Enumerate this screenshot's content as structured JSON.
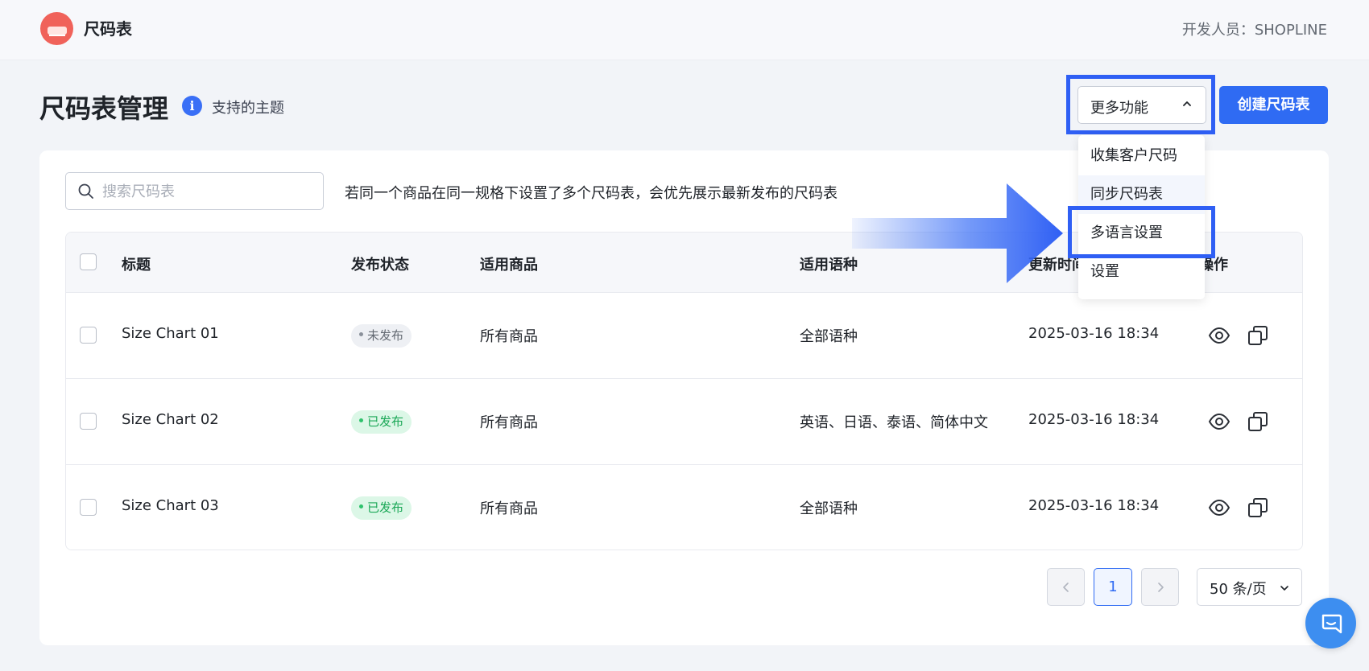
{
  "app": {
    "title": "尺码表",
    "developer": "开发人员：SHOPLINE"
  },
  "header": {
    "page_title": "尺码表管理",
    "themes_link": "支持的主题",
    "more_button": "更多功能",
    "create_button": "创建尺码表"
  },
  "more_menu": {
    "items": [
      "收集客户尺码",
      "同步尺码表",
      "多语言设置",
      "设置"
    ]
  },
  "search": {
    "placeholder": "搜索尺码表",
    "value": ""
  },
  "notice": "若同一个商品在同一规格下设置了多个尺码表，会优先展示最新发布的尺码表",
  "table": {
    "columns": [
      "标题",
      "发布状态",
      "适用商品",
      "适用语种",
      "更新时间",
      "操作"
    ],
    "rows": [
      {
        "title": "Size Chart 01",
        "status": "未发布",
        "products": "所有商品",
        "languages": "全部语种",
        "updated": "2025-03-16 18:34"
      },
      {
        "title": "Size Chart 02",
        "status": "已发布",
        "products": "所有商品",
        "languages": "英语、日语、泰语、简体中文",
        "updated": "2025-03-16 18:34"
      },
      {
        "title": "Size Chart 03",
        "status": "已发布",
        "products": "所有商品",
        "languages": "全部语种",
        "updated": "2025-03-16 18:34"
      }
    ]
  },
  "pagination": {
    "current_page": "1",
    "page_size": "50 条/页"
  },
  "colors": {
    "primary": "#2f6bf3",
    "highlight": "#2f5ff4",
    "published": "#1ba857",
    "draft": "#646a73"
  },
  "icons": [
    "info-icon",
    "search-icon",
    "chevron-up-icon",
    "eye-icon",
    "copy-icon",
    "chevron-left-icon",
    "chevron-right-icon",
    "chevron-down-icon",
    "chat-icon",
    "arrow-right-icon"
  ]
}
